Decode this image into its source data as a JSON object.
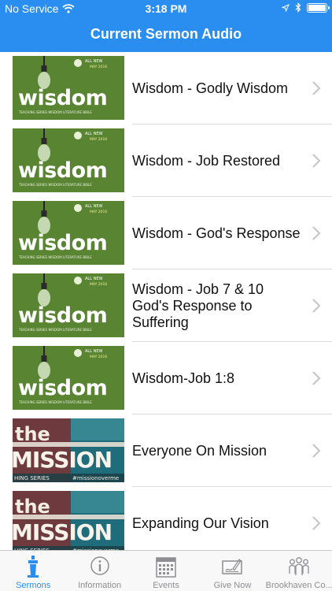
{
  "status": {
    "carrier": "No Service",
    "time": "3:18 PM",
    "icons": [
      "wifi-icon",
      "location-icon",
      "bluetooth-icon",
      "battery-icon"
    ]
  },
  "header": {
    "title": "Current Sermon Audio"
  },
  "colors": {
    "accent": "#2a8ef0",
    "wisdom_bg": "#4f7a2e",
    "mission_bg": "#1f6c7a"
  },
  "sermons": [
    {
      "title": "Wisdom - Godly Wisdom",
      "series": "wisdom"
    },
    {
      "title": "Wisdom - Job Restored",
      "series": "wisdom"
    },
    {
      "title": "Wisdom - God's Response",
      "series": "wisdom"
    },
    {
      "title": "Wisdom - Job 7 & 10 God's Response to Suffering",
      "series": "wisdom"
    },
    {
      "title": "Wisdom-Job 1:8",
      "series": "wisdom"
    },
    {
      "title": "Everyone On Mission",
      "series": "mission"
    },
    {
      "title": "Expanding Our Vision",
      "series": "mission"
    }
  ],
  "thumbs": {
    "wisdom": {
      "word": "wisdom",
      "tag_line": "ALL NEW",
      "date": "MAY 2016",
      "footer": "TEACHING SERIES WISDOM LITERATURE BIBLE"
    },
    "mission": {
      "word1": "the",
      "word2": "MISSION",
      "footer_left": "HING SERIES",
      "footer_right": "#missionoverme"
    }
  },
  "tabs": [
    {
      "label": "Sermons",
      "icon": "pulpit-icon",
      "active": true
    },
    {
      "label": "Information",
      "icon": "info-icon",
      "active": false
    },
    {
      "label": "Events",
      "icon": "calendar-icon",
      "active": false
    },
    {
      "label": "Give Now",
      "icon": "sign-icon",
      "active": false
    },
    {
      "label": "Brookhaven Co...",
      "icon": "people-icon",
      "active": false
    }
  ]
}
